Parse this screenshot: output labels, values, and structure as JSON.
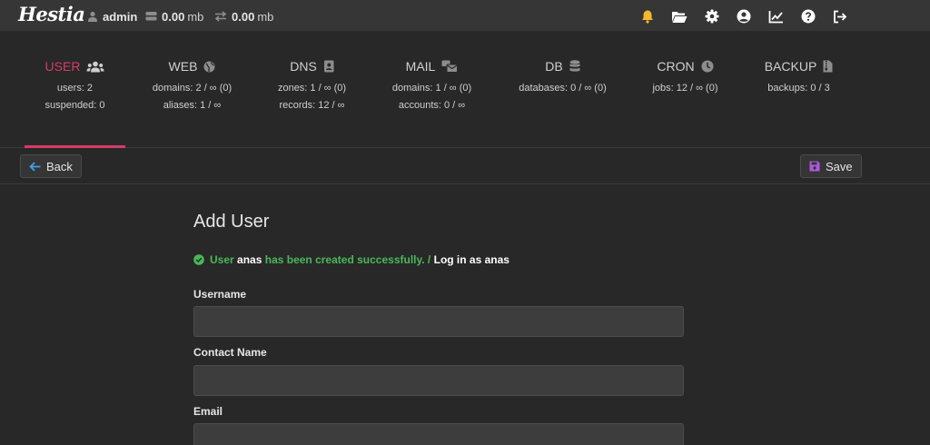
{
  "app": {
    "logo_text": "Hestia"
  },
  "topbar": {
    "user": "admin",
    "disk_value": "0.00",
    "disk_unit": "mb",
    "bandwidth_value": "0.00",
    "bandwidth_unit": "mb",
    "icons": [
      "bell-icon",
      "folder-open-icon",
      "gear-icon",
      "user-circle-icon",
      "chart-line-icon",
      "help-circle-icon",
      "logout-icon"
    ],
    "bell_color": "#f5b82e"
  },
  "tabs": [
    {
      "label": "USER",
      "stats": [
        "users: 2",
        "suspended: 0"
      ],
      "active": true,
      "icon": "users-icon"
    },
    {
      "label": "WEB",
      "stats": [
        "domains: 2 / ∞ (0)",
        "aliases: 1 / ∞"
      ],
      "icon": "globe-icon"
    },
    {
      "label": "DNS",
      "stats": [
        "zones: 1 / ∞ (0)",
        "records: 12 / ∞"
      ],
      "icon": "address-book-icon"
    },
    {
      "label": "MAIL",
      "stats": [
        "domains: 1 / ∞ (0)",
        "accounts: 0 / ∞"
      ],
      "icon": "mail-bulk-icon"
    },
    {
      "label": "DB",
      "stats": [
        "databases: 0 / ∞ (0)"
      ],
      "icon": "database-icon"
    },
    {
      "label": "CRON",
      "stats": [
        "jobs: 12 / ∞ (0)"
      ],
      "icon": "clock-icon"
    },
    {
      "label": "BACKUP",
      "stats": [
        "backups: 0 / 3"
      ],
      "icon": "file-archive-icon"
    }
  ],
  "accent_color": "#d63b6a",
  "toolbar": {
    "back_label": "Back",
    "save_label": "Save"
  },
  "form": {
    "title": "Add User",
    "alert": {
      "prefix": "User",
      "username": "anas",
      "middle": "has been created successfully. /",
      "login_link": "Log in as anas"
    },
    "fields": [
      {
        "label": "Username",
        "value": ""
      },
      {
        "label": "Contact Name",
        "value": ""
      },
      {
        "label": "Email",
        "value": ""
      }
    ]
  },
  "success_color": "#49b858"
}
